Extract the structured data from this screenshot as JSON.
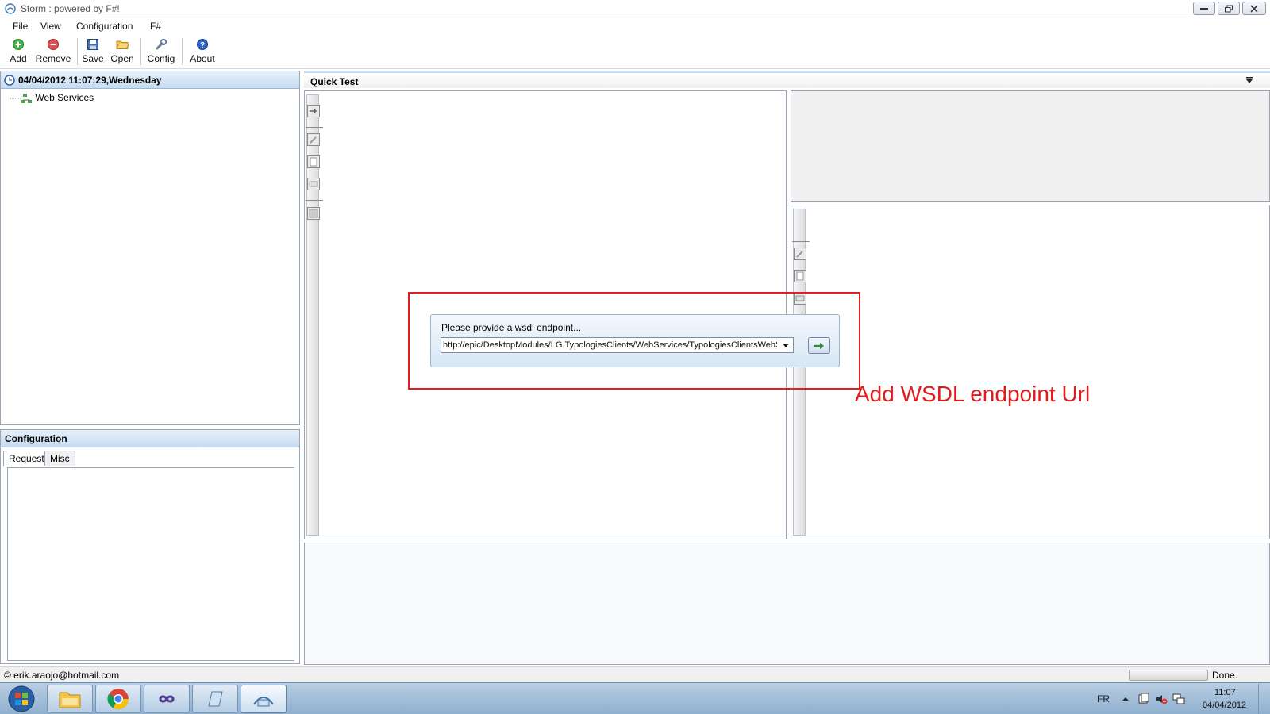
{
  "window": {
    "title": "Storm : powered by F#!"
  },
  "menu": [
    "File",
    "View",
    "Configuration",
    "F#"
  ],
  "toolbar": {
    "add": "Add",
    "remove": "Remove",
    "save": "Save",
    "open": "Open",
    "config": "Config",
    "about": "About"
  },
  "explorer": {
    "header": "04/04/2012 11:07:29,Wednesday",
    "tree_item": "Web Services"
  },
  "config_pane": {
    "header": "Configuration",
    "tabs": [
      "Request",
      "Misc"
    ]
  },
  "main": {
    "tab_label": "Quick Test"
  },
  "wsdl_dialog": {
    "label": "Please provide a wsdl endpoint...",
    "value": "http://epic/DesktopModules/LG.TypologiesClients/WebServices/TypologiesClientsWebService.asmx?WSDL"
  },
  "annotation": {
    "text": "Add WSDL endpoint Url",
    "color": "#e41b1b"
  },
  "status": {
    "left": "© erik.araojo@hotmail.com",
    "right": "Done."
  },
  "taskbar": {
    "lang": "FR",
    "time": "11:07",
    "date": "04/04/2012"
  }
}
